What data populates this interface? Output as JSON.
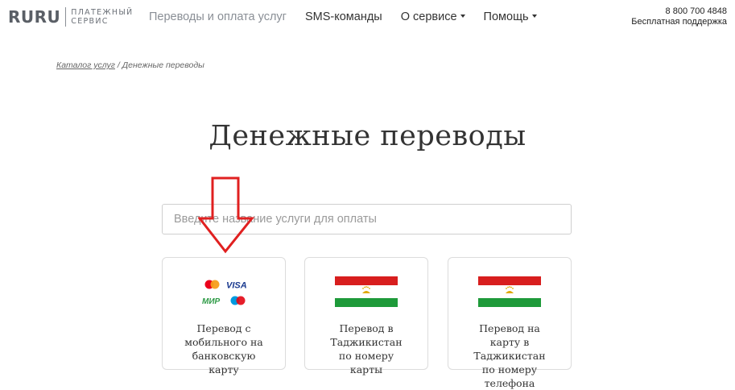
{
  "header": {
    "logo_mark": "RURU",
    "logo_sub_line1": "ПЛАТЕЖНЫЙ",
    "logo_sub_line2": "СЕРВИС",
    "nav": [
      {
        "label": "Переводы и оплата услуг"
      },
      {
        "label": "SMS-команды"
      },
      {
        "label": "О сервисе",
        "has_caret": true
      },
      {
        "label": "Помощь",
        "has_caret": true
      }
    ],
    "support_phone": "8 800 700 4848",
    "support_label": "Бесплатная поддержка"
  },
  "breadcrumb": {
    "catalog_link": "Каталог услуг",
    "separator": " / ",
    "current": "Денежные переводы"
  },
  "page_title": "Денежные переводы",
  "search": {
    "placeholder": "Введите название услуги для оплаты",
    "value": ""
  },
  "cards": [
    {
      "label": "Перевод с мобильного на банковскую карту",
      "icon": "payment-systems-icon"
    },
    {
      "label": "Перевод в Таджикистан по номеру карты",
      "icon": "tajikistan-flag-icon"
    },
    {
      "label": "Перевод на карту в Таджикистан по номеру телефона",
      "icon": "tajikistan-flag-icon"
    }
  ],
  "payment_logos": {
    "visa": "VISA",
    "mir": "МИР"
  },
  "colors": {
    "arrow": "#e02020",
    "flag_red": "#d81e1e",
    "flag_green": "#1e9a3a",
    "mastercard_red": "#eb001b",
    "mastercard_orange": "#f79e1b",
    "visa_blue": "#1a3a8f",
    "mir_green": "#2f9b47",
    "maestro_blue": "#0099df"
  }
}
